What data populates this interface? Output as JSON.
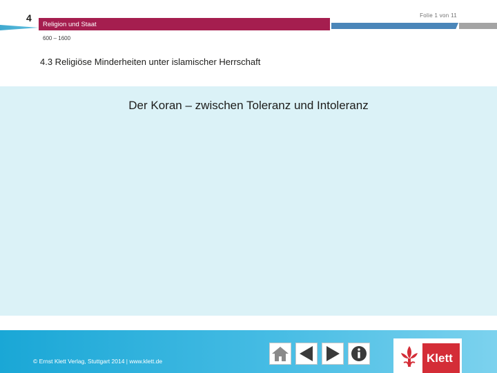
{
  "header": {
    "chapter_number": "4",
    "chapter_title": "Religion und Staat",
    "period": "600 – 1600",
    "slide_counter": "Folie 1 von 11"
  },
  "section": {
    "heading": "4.3 Religiöse Minderheiten unter islamischer Herrschaft"
  },
  "main": {
    "title": "Der Koran – zwischen Toleranz und Intoleranz"
  },
  "footer": {
    "copyright": "© Ernst Klett Verlag, Stuttgart 2014 | www.klett.de",
    "nav_icons": [
      "home-icon",
      "previous-arrow-icon",
      "next-arrow-icon",
      "info-icon"
    ],
    "logo_text": "Klett"
  },
  "colors": {
    "chapter_band": "#a51e4f",
    "blue_band": "#4a86b9",
    "content_background": "#dbf2f7",
    "footer_blue": "#1aa7d6",
    "logo_red": "#d42d37"
  }
}
